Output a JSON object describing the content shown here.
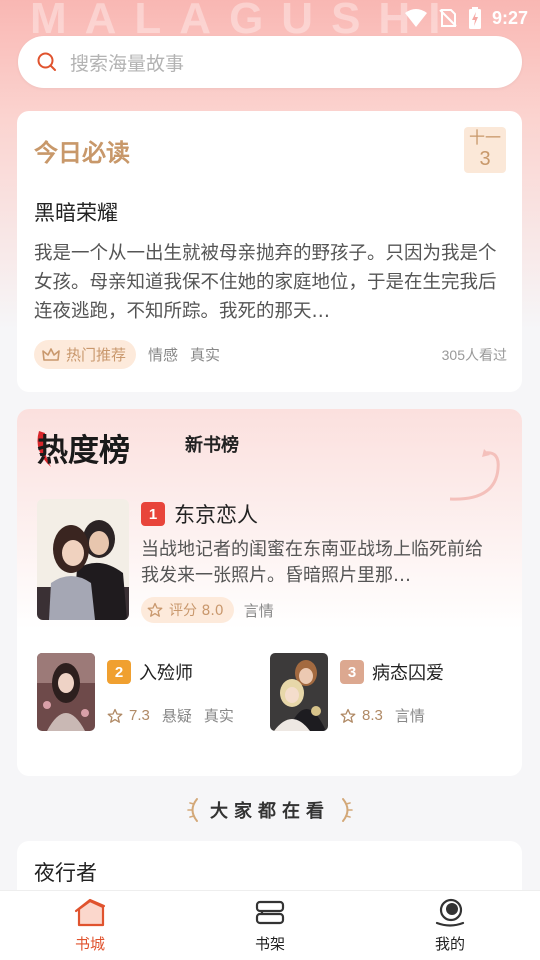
{
  "app": {
    "brand_watermark": "MALAGUSHI"
  },
  "status_bar": {
    "time": "9:27"
  },
  "search": {
    "placeholder": "搜索海量故事",
    "icon": "search-icon"
  },
  "today_card": {
    "title": "今日必读",
    "date_month": "十一",
    "date_day": "3",
    "book_title": "黑暗荣耀",
    "description": "我是一个从一出生就被母亲抛弃的野孩子。只因为我是个女孩。母亲知道我保不住她的家庭地位，于是在生完我后连夜逃跑，不知所踪。我死的那天…",
    "hot_tag": "热门推荐",
    "tags": [
      "情感",
      "真实"
    ],
    "views": "305人看过"
  },
  "ranking": {
    "tabs": [
      "热度榜",
      "新书榜"
    ],
    "first": {
      "rank": "1",
      "title": "东京恋人",
      "description": "当战地记者的闺蜜在东南亚战场上临死前给我发来一张照片。昏暗照片里那…",
      "score_label": "评分 8.0",
      "genre": "言情"
    },
    "others": [
      {
        "rank": "2",
        "title": "入殓师",
        "score": "7.3",
        "tags": [
          "悬疑",
          "真实"
        ]
      },
      {
        "rank": "3",
        "title": "病态囚爱",
        "score": "8.3",
        "tags": [
          "言情"
        ]
      }
    ]
  },
  "section": {
    "title": "大家都在看"
  },
  "next_item": {
    "title": "夜行者"
  },
  "bottom_nav": [
    {
      "label": "书城",
      "icon": "home-icon",
      "active": true
    },
    {
      "label": "书架",
      "icon": "bookshelf-icon",
      "active": false
    },
    {
      "label": "我的",
      "icon": "profile-icon",
      "active": false
    }
  ],
  "colors": {
    "accent": "#e0532e",
    "gold": "#c8986a",
    "rank1": "#e8443a",
    "rank2": "#f0a030",
    "rank3": "#dca890"
  }
}
